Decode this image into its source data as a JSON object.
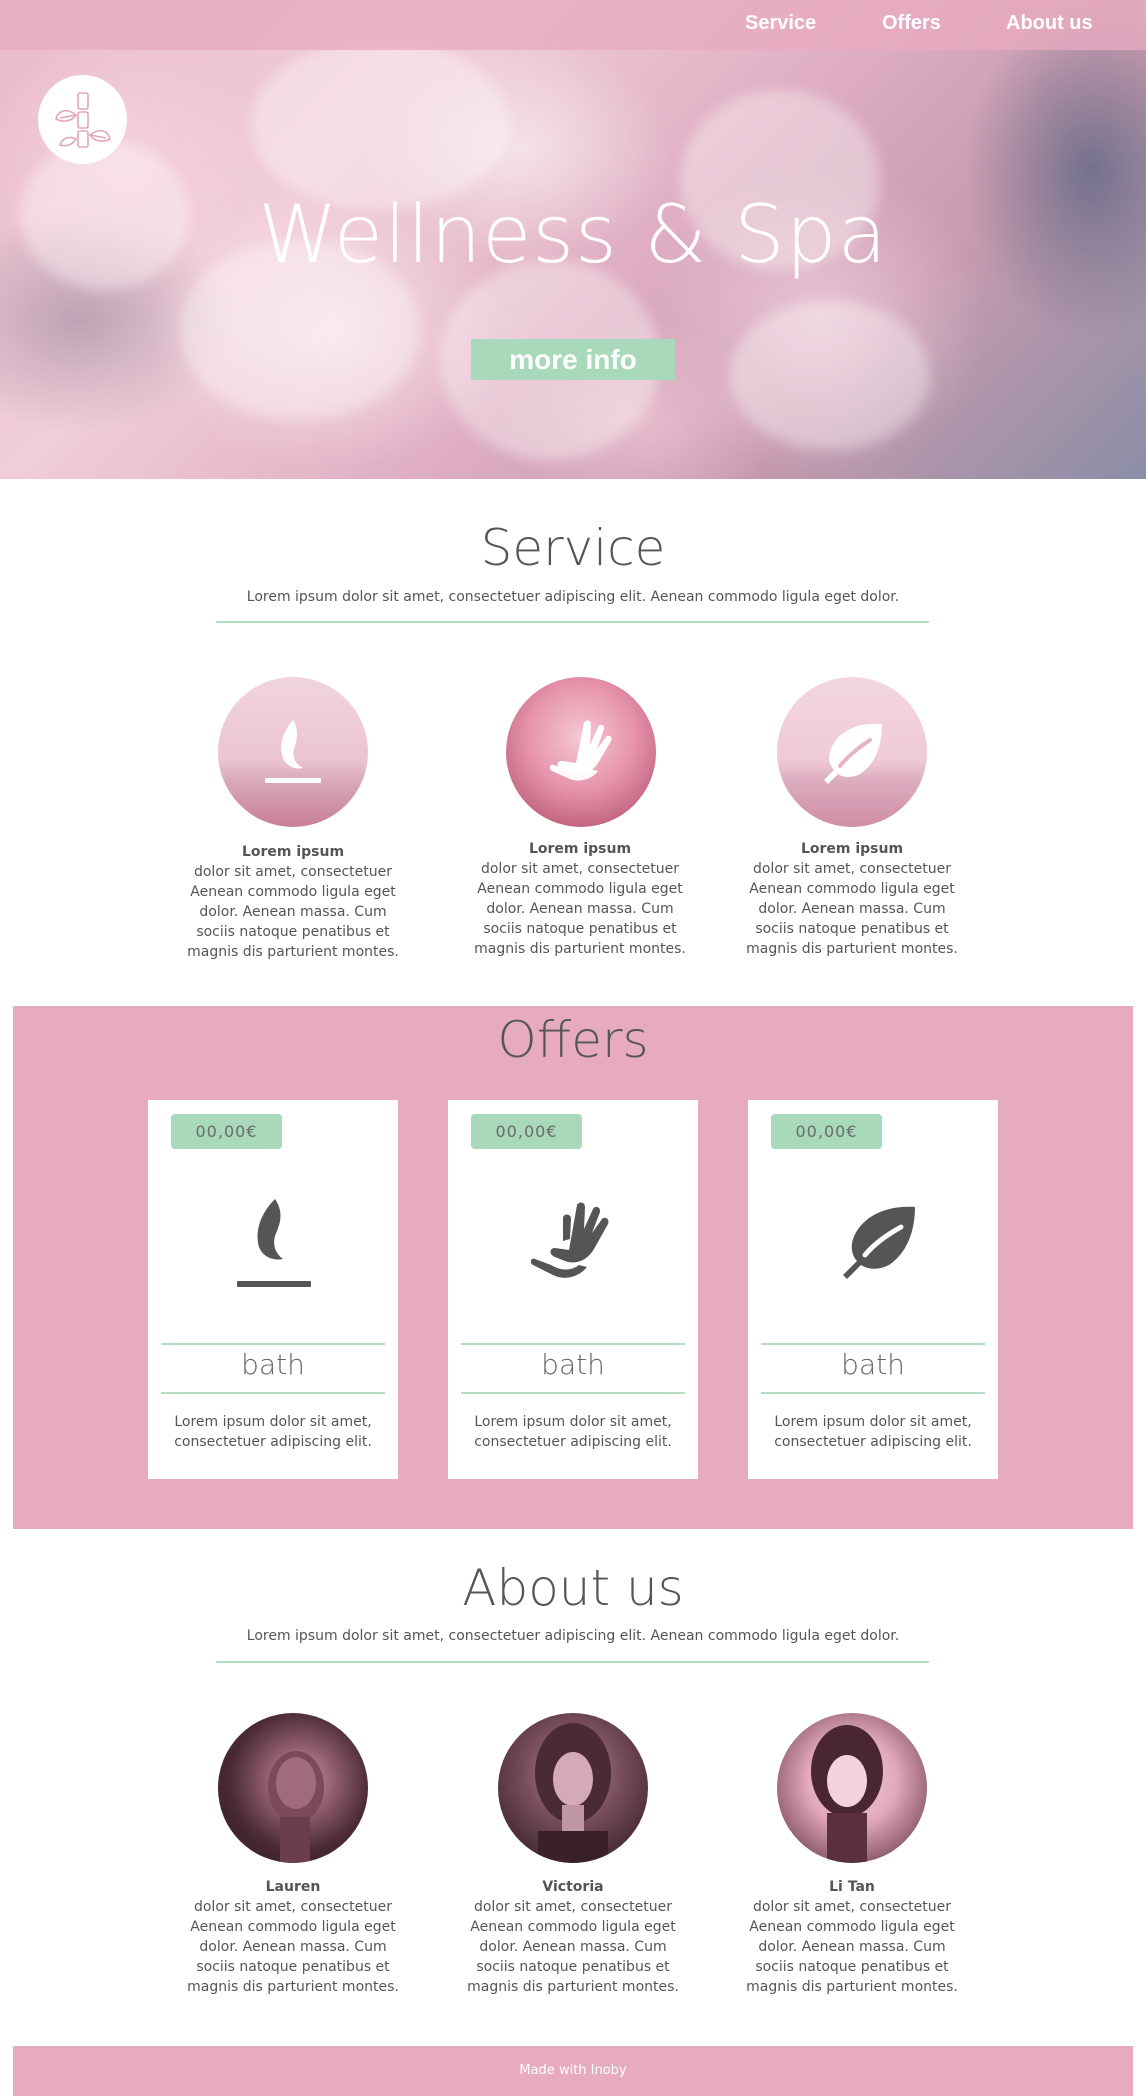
{
  "nav": {
    "items": [
      {
        "label": "Service"
      },
      {
        "label": "Offers"
      },
      {
        "label": "About us"
      }
    ]
  },
  "hero": {
    "title": "Wellness & Spa",
    "button_label": "more info",
    "logo_icon": "bamboo-leaf-logo-icon"
  },
  "service": {
    "title": "Service",
    "subtitle": "Lorem ipsum dolor sit amet, consectetuer adipiscing elit. Aenean commodo ligula eget dolor.",
    "items": [
      {
        "icon": "flame-icon",
        "heading": "Lorem ipsum",
        "body": "dolor sit amet, consectetuer Aenean commodo ligula eget dolor. Aenean massa. Cum sociis natoque penatibus et magnis dis parturient montes."
      },
      {
        "icon": "hands-icon",
        "heading": "Lorem ipsum",
        "body": "dolor sit amet, consectetuer Aenean commodo ligula eget dolor. Aenean massa. Cum sociis natoque penatibus et magnis dis parturient montes."
      },
      {
        "icon": "leaf-icon",
        "heading": "Lorem ipsum",
        "body": "dolor sit amet, consectetuer Aenean commodo ligula eget dolor. Aenean massa. Cum sociis natoque penatibus et magnis dis parturient montes."
      }
    ]
  },
  "offers": {
    "title": "Offers",
    "cards": [
      {
        "price": "00,00€",
        "icon": "flame-icon",
        "name": "bath",
        "desc": "Lorem ipsum dolor sit amet, consectetuer adipiscing elit."
      },
      {
        "price": "00,00€",
        "icon": "hands-icon",
        "name": "bath",
        "desc": "Lorem ipsum dolor sit amet, consectetuer adipiscing elit."
      },
      {
        "price": "00,00€",
        "icon": "leaf-icon",
        "name": "bath",
        "desc": "Lorem ipsum dolor sit amet, consectetuer adipiscing elit."
      }
    ]
  },
  "about": {
    "title": "About us",
    "subtitle": "Lorem ipsum dolor sit amet, consectetuer adipiscing elit. Aenean commodo ligula eget dolor.",
    "members": [
      {
        "name": "Lauren",
        "body": "dolor sit amet, consectetuer Aenean commodo ligula eget dolor. Aenean massa. Cum sociis natoque penatibus et magnis dis parturient montes."
      },
      {
        "name": "Victoria",
        "body": "dolor sit amet, consectetuer Aenean commodo ligula eget dolor. Aenean massa. Cum sociis natoque penatibus et magnis dis parturient montes."
      },
      {
        "name": "Li Tan",
        "body": "dolor sit amet, consectetuer Aenean commodo ligula eget dolor. Aenean massa. Cum sociis natoque penatibus et magnis dis parturient montes."
      }
    ]
  },
  "footer": {
    "text": "Made with Inoby"
  },
  "colors": {
    "pink": "#e7abbf",
    "green": "#a9d9bb",
    "text": "#555555"
  }
}
